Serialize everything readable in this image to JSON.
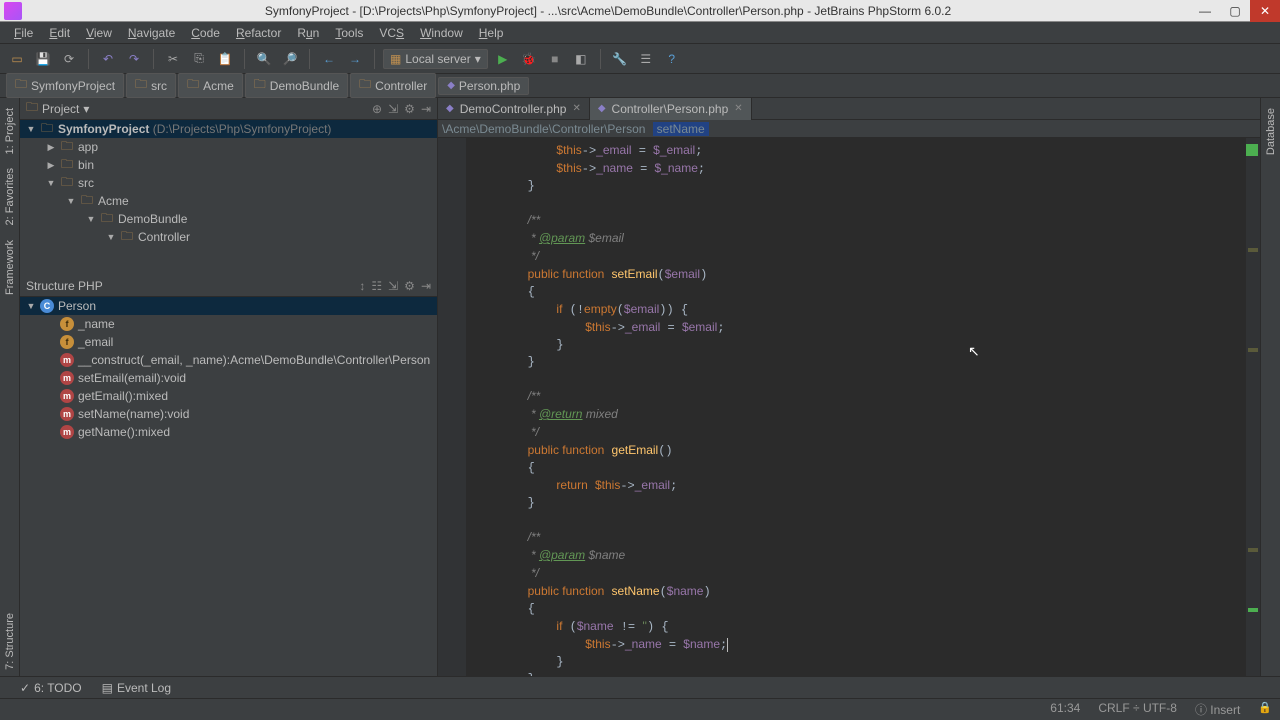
{
  "title": "SymfonyProject - [D:\\Projects\\Php\\SymfonyProject] - ...\\src\\Acme\\DemoBundle\\Controller\\Person.php - JetBrains PhpStorm 6.0.2",
  "menu": [
    "File",
    "Edit",
    "View",
    "Navigate",
    "Code",
    "Refactor",
    "Run",
    "Tools",
    "VCS",
    "Window",
    "Help"
  ],
  "runconfig": "Local server",
  "breadcrumbs": [
    "SymfonyProject",
    "src",
    "Acme",
    "DemoBundle",
    "Controller",
    "Person.php"
  ],
  "project_panel": {
    "title": "Project",
    "root": "SymfonyProject",
    "root_hint": "(D:\\Projects\\Php\\SymfonyProject)",
    "nodes": [
      "app",
      "bin",
      "src",
      "Acme",
      "DemoBundle",
      "Controller"
    ]
  },
  "structure_panel": {
    "title": "Structure PHP",
    "class": "Person",
    "members": [
      {
        "kind": "f",
        "label": "_name"
      },
      {
        "kind": "f",
        "label": "_email"
      },
      {
        "kind": "m",
        "label": "__construct(_email, _name):Acme\\DemoBundle\\Controller\\Person"
      },
      {
        "kind": "m",
        "label": "setEmail(email):void"
      },
      {
        "kind": "m",
        "label": "getEmail():mixed"
      },
      {
        "kind": "m",
        "label": "setName(name):void"
      },
      {
        "kind": "m",
        "label": "getName():mixed"
      }
    ]
  },
  "tabs": [
    {
      "label": "DemoController.php",
      "active": false
    },
    {
      "label": "Controller\\Person.php",
      "active": true
    }
  ],
  "editor_breadcrumb": {
    "path": "\\Acme\\DemoBundle\\Controller\\Person",
    "method": "setName"
  },
  "bottom": {
    "todo": "6: TODO",
    "eventlog": "Event Log"
  },
  "status": {
    "pos": "61:34",
    "crlf": "CRLF",
    "enc": "UTF-8",
    "insert": "Insert"
  },
  "sidetabs": {
    "left": [
      "1: Project",
      "2: Favorites",
      "Framework",
      "7: Structure"
    ],
    "right": [
      "Database"
    ]
  }
}
